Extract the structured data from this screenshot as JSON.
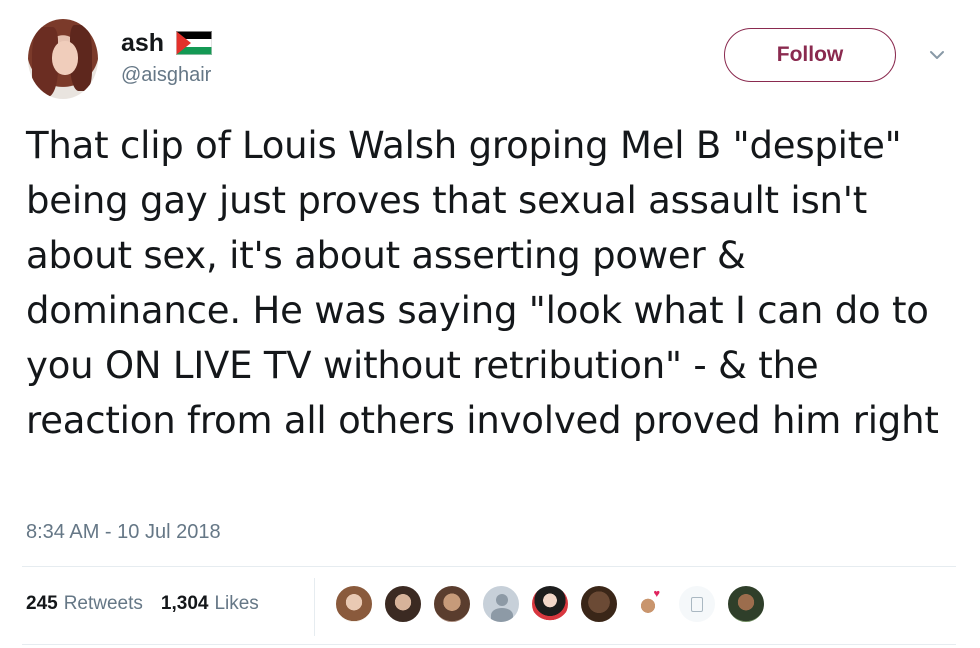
{
  "user": {
    "display_name": "ash",
    "handle": "@aisghair"
  },
  "actions": {
    "follow_label": "Follow"
  },
  "tweet": {
    "text": "That clip of Louis Walsh groping Mel B \"despite\" being gay just proves that sexual assault isn't about sex, it's about asserting power & dominance. He was saying \"look what I can do to you ON LIVE TV without retribution\" - & the reaction from all others involved proved him right",
    "timestamp": "8:34 AM - 10 Jul 2018"
  },
  "stats": {
    "retweets_count": "245",
    "retweets_label": "Retweets",
    "likes_count": "1,304",
    "likes_label": "Likes"
  },
  "icons": {
    "flag": "palestine-flag-icon",
    "caret": "chevron-down-icon"
  },
  "colors": {
    "follow_accent": "#8a2a4f",
    "secondary_text": "#657786",
    "primary_text": "#14171a",
    "divider": "#e6ecf0"
  }
}
